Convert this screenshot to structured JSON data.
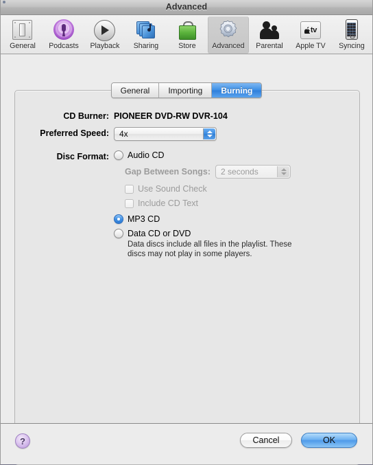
{
  "window": {
    "title": "Advanced"
  },
  "toolbar": {
    "items": [
      {
        "label": "General",
        "icon": "ipod-icon",
        "selected": false
      },
      {
        "label": "Podcasts",
        "icon": "podcast-icon",
        "selected": false
      },
      {
        "label": "Playback",
        "icon": "play-icon",
        "selected": false
      },
      {
        "label": "Sharing",
        "icon": "sharing-icon",
        "selected": false
      },
      {
        "label": "Store",
        "icon": "store-bag-icon",
        "selected": false
      },
      {
        "label": "Advanced",
        "icon": "gear-icon",
        "selected": true
      },
      {
        "label": "Parental",
        "icon": "people-icon",
        "selected": false
      },
      {
        "label": "Apple TV",
        "icon": "apple-tv-icon",
        "selected": false
      },
      {
        "label": "Syncing",
        "icon": "iphone-icon",
        "selected": false
      }
    ]
  },
  "tabs": [
    {
      "label": "General",
      "active": false
    },
    {
      "label": "Importing",
      "active": false
    },
    {
      "label": "Burning",
      "active": true
    }
  ],
  "burning": {
    "cd_burner_label": "CD Burner:",
    "cd_burner_value": "PIONEER DVD-RW  DVR-104",
    "preferred_speed_label": "Preferred Speed:",
    "preferred_speed_value": "4x",
    "disc_format_label": "Disc Format:",
    "options": [
      {
        "label": "Audio CD",
        "selected": false
      },
      {
        "label": "MP3 CD",
        "selected": true
      },
      {
        "label": "Data CD or DVD",
        "selected": false
      }
    ],
    "audio_cd": {
      "gap_label": "Gap Between Songs:",
      "gap_value": "2 seconds",
      "sound_check_label": "Use Sound Check",
      "sound_check_checked": false,
      "cd_text_label": "Include CD Text",
      "cd_text_checked": false
    },
    "data_cd_help": "Data discs include all files in the playlist. These discs may not play in some players."
  },
  "footer": {
    "help_label": "?",
    "cancel_label": "Cancel",
    "ok_label": "OK"
  },
  "icons": {
    "apple_tv_text": "tv"
  },
  "colors": {
    "accent_blue": "#3d8fe6",
    "window_bg": "#ececec",
    "panel_bg": "#e7e7e7",
    "disabled_text": "#9c9c9c"
  }
}
